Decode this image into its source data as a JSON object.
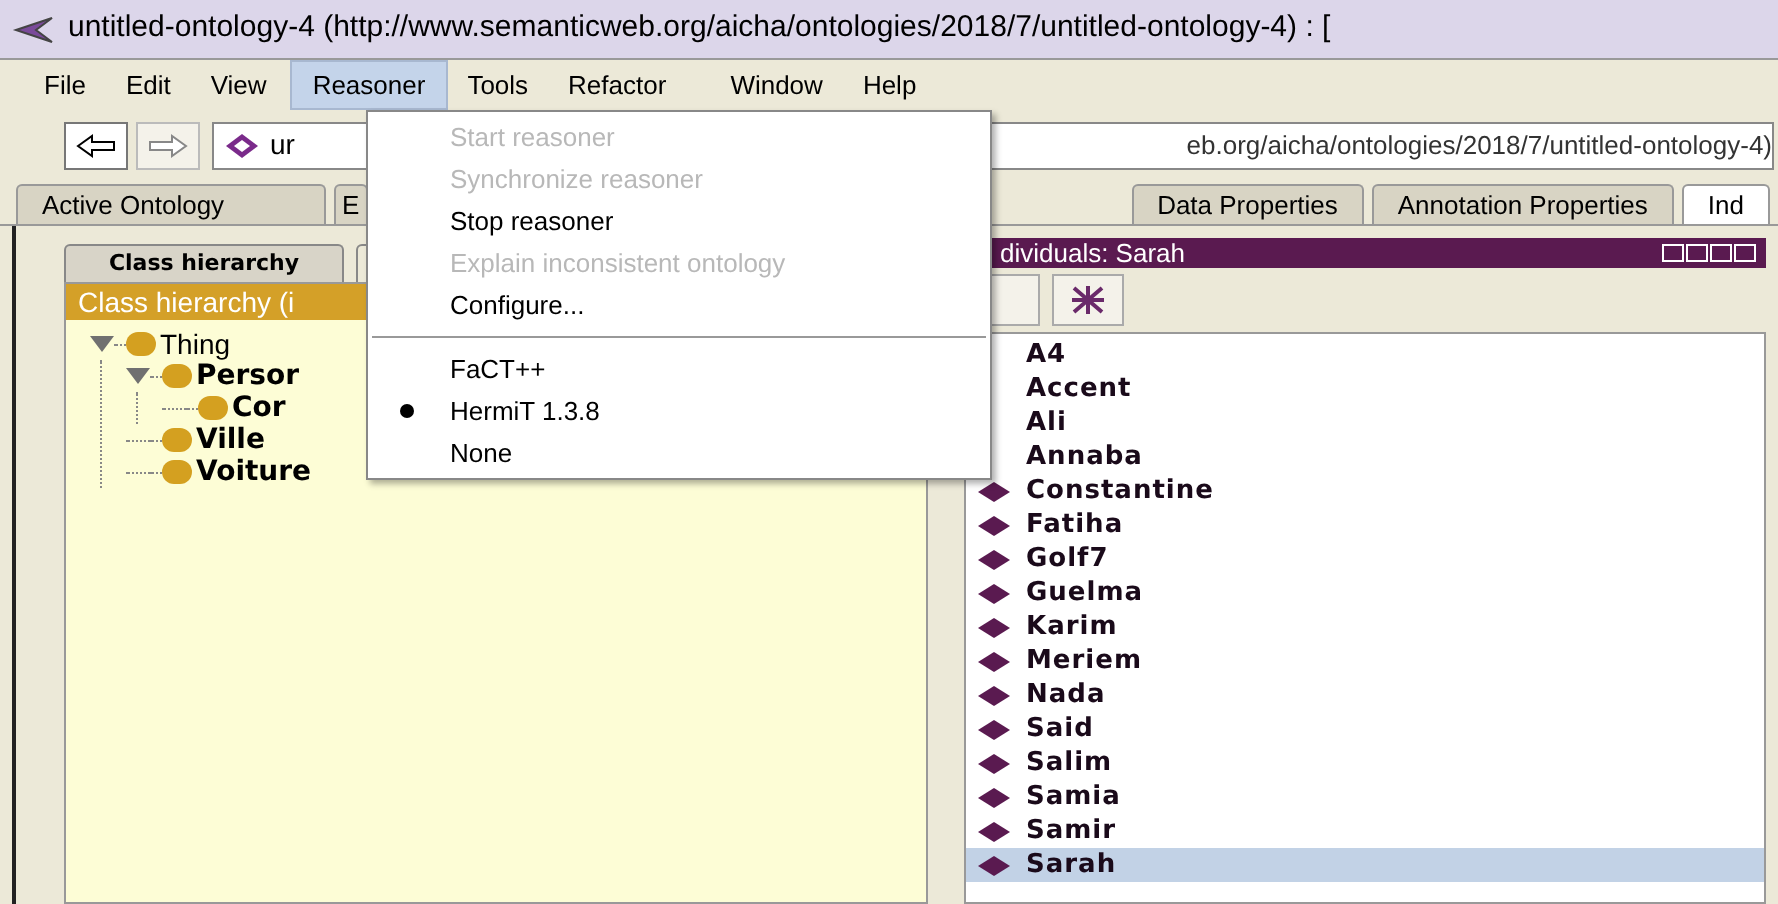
{
  "window": {
    "title": "untitled-ontology-4 (http://www.semanticweb.org/aicha/ontologies/2018/7/untitled-ontology-4)  : ["
  },
  "menu_bar": [
    {
      "label": "File",
      "selected": false
    },
    {
      "label": "Edit",
      "selected": false
    },
    {
      "label": "View",
      "selected": false
    },
    {
      "label": "Reasoner",
      "selected": true
    },
    {
      "label": "Tools",
      "selected": false
    },
    {
      "label": "Refactor",
      "selected": false
    },
    {
      "label": "Window",
      "selected": false
    },
    {
      "label": "Help",
      "selected": false
    }
  ],
  "reasoner_menu": [
    {
      "kind": "action",
      "label": "Start reasoner",
      "disabled": true
    },
    {
      "kind": "action",
      "label": "Synchronize reasoner",
      "disabled": true
    },
    {
      "kind": "action",
      "label": "Stop reasoner",
      "disabled": false
    },
    {
      "kind": "action",
      "label": "Explain inconsistent ontology",
      "disabled": true
    },
    {
      "kind": "action",
      "label": "Configure...",
      "disabled": false
    },
    {
      "kind": "separator"
    },
    {
      "kind": "radio",
      "label": "FaCT++",
      "selected": false
    },
    {
      "kind": "radio",
      "label": "HermiT 1.3.8",
      "selected": true
    },
    {
      "kind": "radio",
      "label": "None",
      "selected": false
    }
  ],
  "toolbar": {
    "ontology_combo": "ur",
    "ontology_iri": "eb.org/aicha/ontologies/2018/7/untitled-ontology-4)"
  },
  "tabs": [
    {
      "label": "Active Ontology",
      "selected": false
    },
    {
      "label": "E",
      "selected": false
    },
    {
      "label": "Data Properties",
      "selected": false
    },
    {
      "label": "Annotation Properties",
      "selected": false
    },
    {
      "label": "Ind",
      "selected": true
    }
  ],
  "class_panel": {
    "tabs": [
      {
        "label": "Class hierarchy",
        "selected": true
      }
    ],
    "header": "Class hierarchy (i",
    "tree": [
      {
        "label": "Thing",
        "bold": false,
        "expanded": true,
        "children": [
          {
            "label": "Persor",
            "bold": true,
            "expanded": true,
            "children": [
              {
                "label": "Cor",
                "bold": true
              }
            ]
          },
          {
            "label": "Ville",
            "bold": true
          },
          {
            "label": "Voiture",
            "bold": true
          }
        ]
      }
    ]
  },
  "individuals_panel": {
    "header": "dividuals: Sarah",
    "items": [
      {
        "label": "A4",
        "icon": false,
        "selected": false
      },
      {
        "label": "Accent",
        "icon": false,
        "selected": false
      },
      {
        "label": "Ali",
        "icon": false,
        "selected": false
      },
      {
        "label": "Annaba",
        "icon": false,
        "selected": false
      },
      {
        "label": "Constantine",
        "icon": true,
        "selected": false
      },
      {
        "label": "Fatiha",
        "icon": true,
        "selected": false
      },
      {
        "label": "Golf7",
        "icon": true,
        "selected": false
      },
      {
        "label": "Guelma",
        "icon": true,
        "selected": false
      },
      {
        "label": "Karim",
        "icon": true,
        "selected": false
      },
      {
        "label": "Meriem",
        "icon": true,
        "selected": false
      },
      {
        "label": "Nada",
        "icon": true,
        "selected": false
      },
      {
        "label": "Said",
        "icon": true,
        "selected": false
      },
      {
        "label": "Salim",
        "icon": true,
        "selected": false
      },
      {
        "label": "Samia",
        "icon": true,
        "selected": false
      },
      {
        "label": "Samir",
        "icon": true,
        "selected": false
      },
      {
        "label": "Sarah",
        "icon": true,
        "selected": true
      }
    ]
  }
}
